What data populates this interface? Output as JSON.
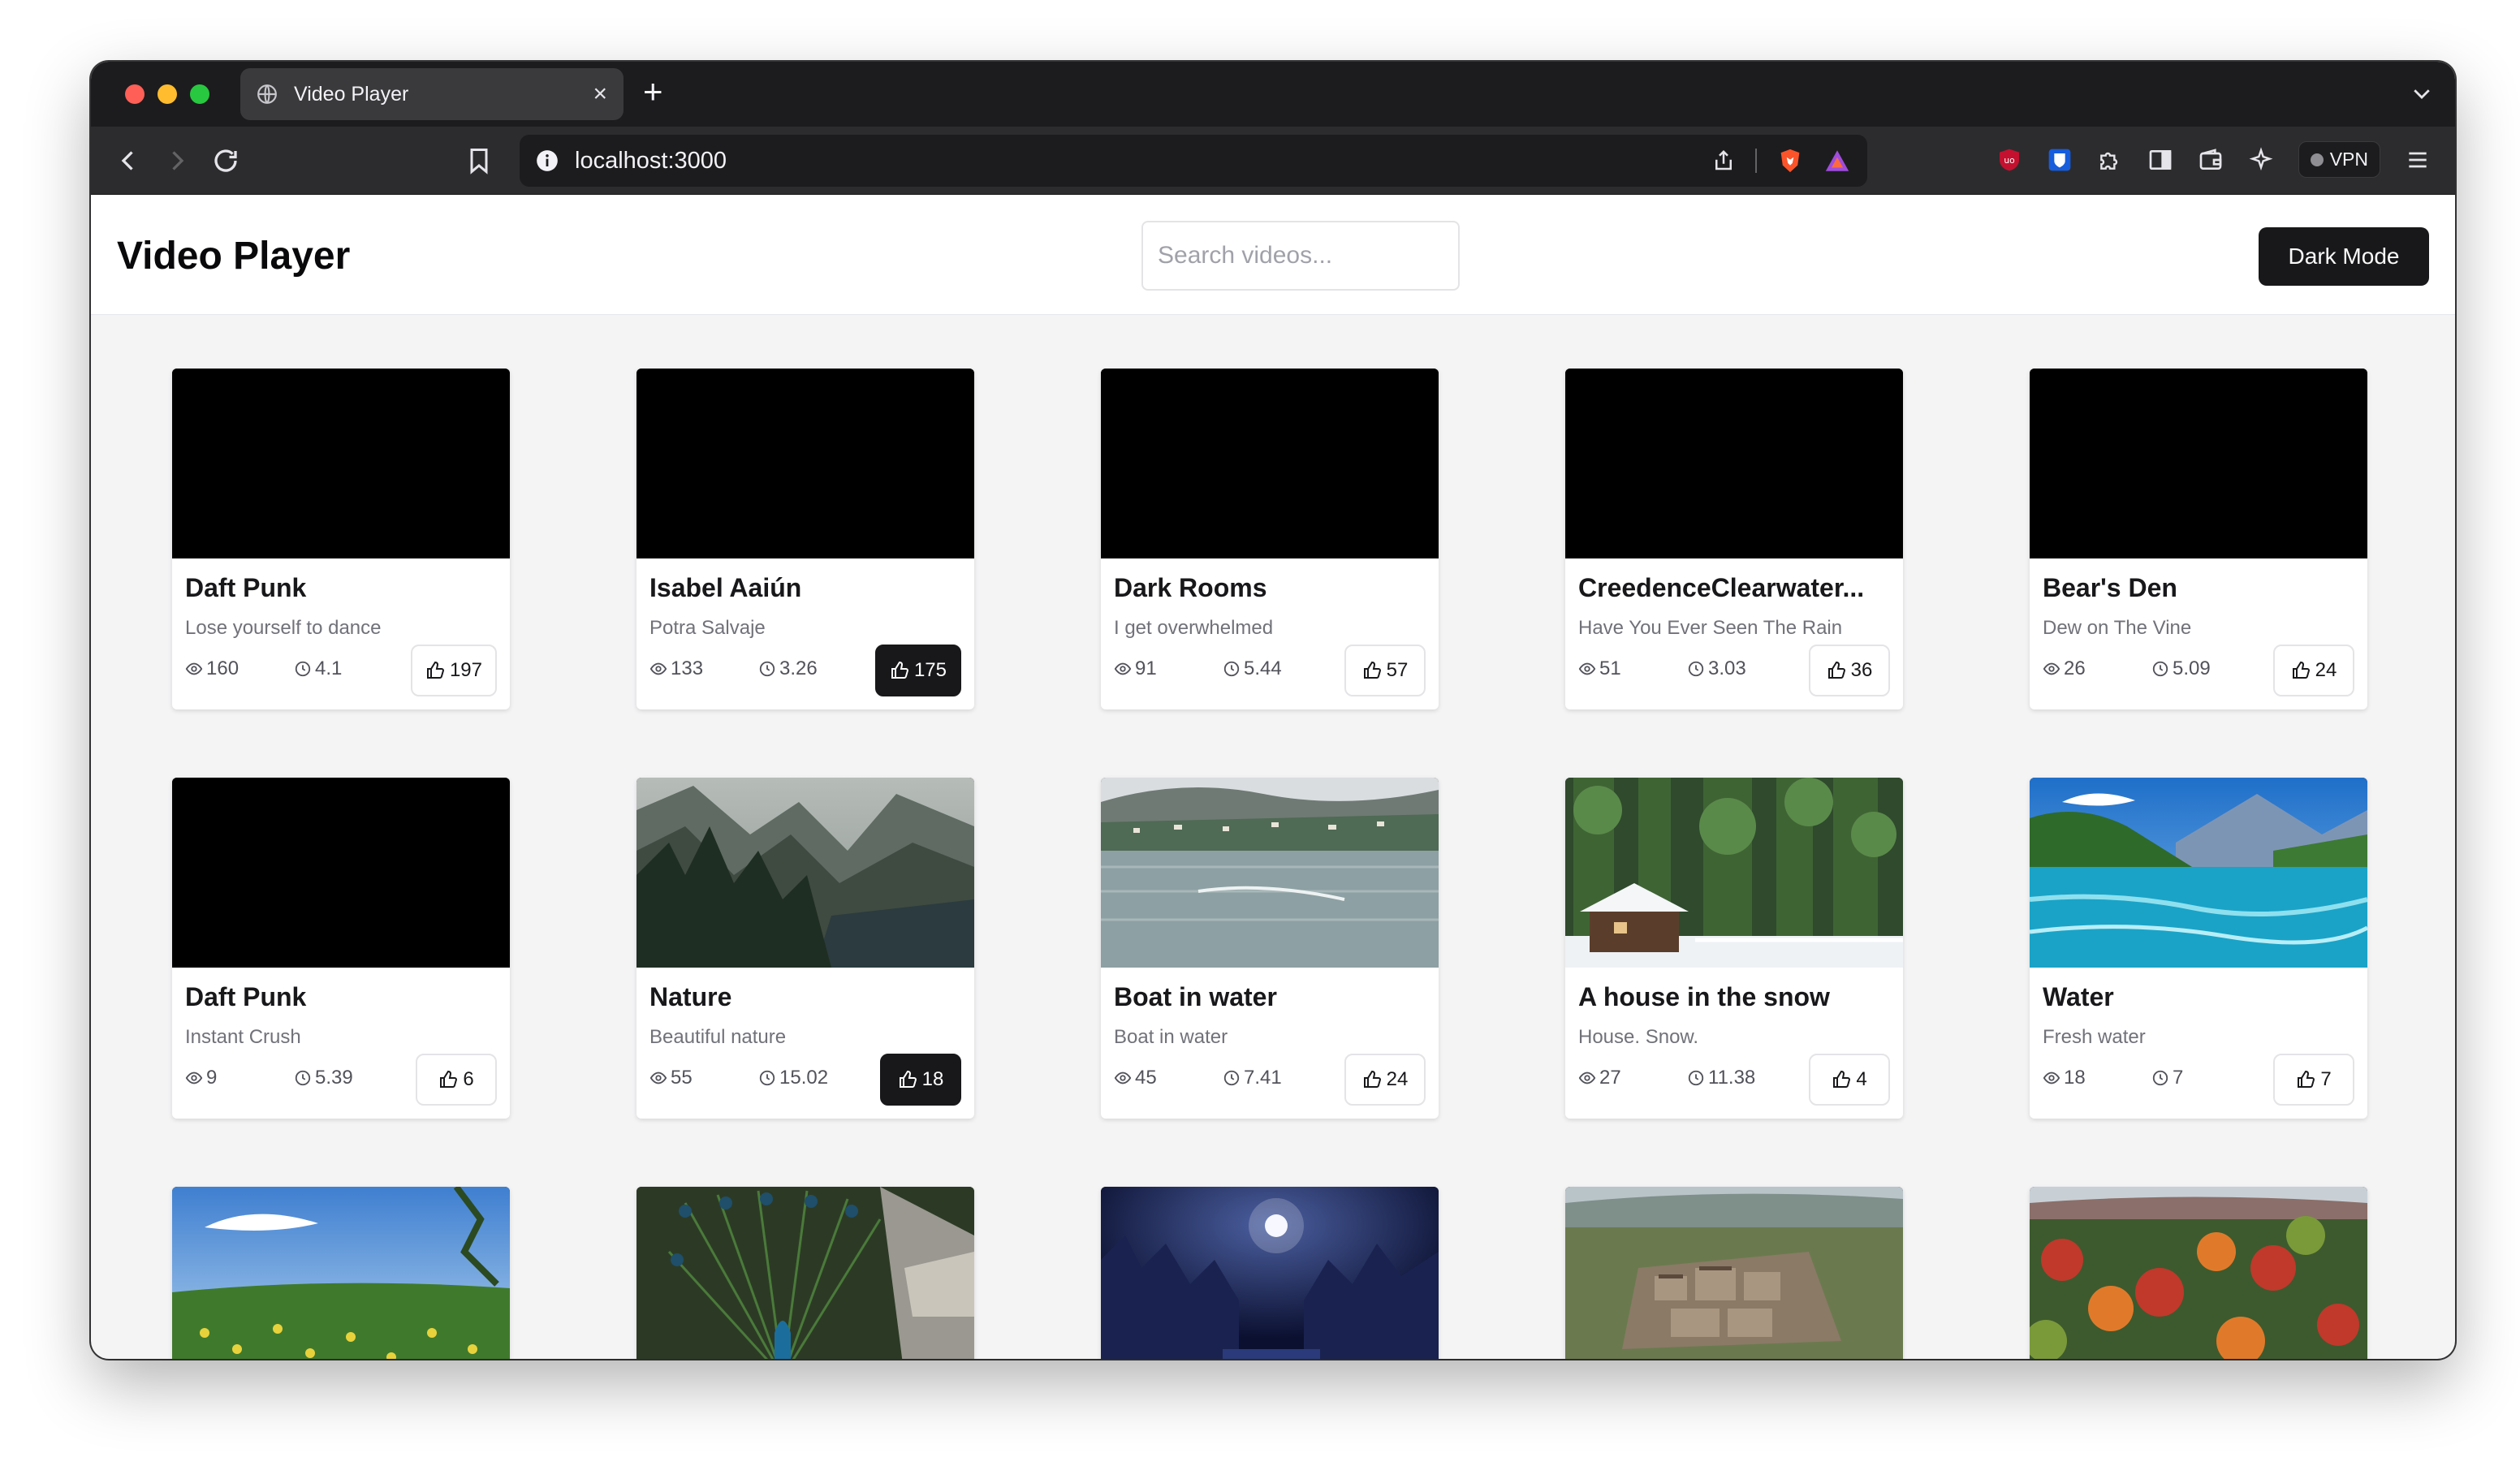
{
  "browser": {
    "tab_title": "Video Player",
    "tab_close": "×",
    "new_tab": "+",
    "url": "localhost:3000",
    "vpn_label": "VPN"
  },
  "app": {
    "title": "Video Player",
    "search_placeholder": "Search videos...",
    "dark_mode_label": "Dark Mode"
  },
  "videos": [
    {
      "title": "Daft Punk",
      "description": "Lose yourself to dance",
      "views": "160",
      "duration": "4.1",
      "likes": "197",
      "liked": false,
      "thumb": "black"
    },
    {
      "title": "Isabel Aaiún",
      "description": "Potra Salvaje",
      "views": "133",
      "duration": "3.26",
      "likes": "175",
      "liked": true,
      "thumb": "black"
    },
    {
      "title": "Dark Rooms",
      "description": "I get overwhelmed",
      "views": "91",
      "duration": "5.44",
      "likes": "57",
      "liked": false,
      "thumb": "black"
    },
    {
      "title": "CreedenceClearwater...",
      "description": "Have You Ever Seen The Rain",
      "views": "51",
      "duration": "3.03",
      "likes": "36",
      "liked": false,
      "thumb": "black"
    },
    {
      "title": "Bear's Den",
      "description": "Dew on The Vine",
      "views": "26",
      "duration": "5.09",
      "likes": "24",
      "liked": false,
      "thumb": "black"
    },
    {
      "title": "Daft Punk",
      "description": "Instant Crush",
      "views": "9",
      "duration": "5.39",
      "likes": "6",
      "liked": false,
      "thumb": "black"
    },
    {
      "title": "Nature",
      "description": "Beautiful nature",
      "views": "55",
      "duration": "15.02",
      "likes": "18",
      "liked": true,
      "thumb": "mountains"
    },
    {
      "title": "Boat in water",
      "description": "Boat in water",
      "views": "45",
      "duration": "7.41",
      "likes": "24",
      "liked": false,
      "thumb": "lake"
    },
    {
      "title": "A house in the snow",
      "description": "House. Snow.",
      "views": "27",
      "duration": "11.38",
      "likes": "4",
      "liked": false,
      "thumb": "snowhouse"
    },
    {
      "title": "Water",
      "description": "Fresh water",
      "views": "18",
      "duration": "7",
      "likes": "7",
      "liked": false,
      "thumb": "river"
    },
    {
      "title": "",
      "description": "",
      "views": "",
      "duration": "",
      "likes": "",
      "liked": false,
      "thumb": "meadow"
    },
    {
      "title": "",
      "description": "",
      "views": "",
      "duration": "",
      "likes": "",
      "liked": false,
      "thumb": "peacock"
    },
    {
      "title": "",
      "description": "",
      "views": "",
      "duration": "",
      "likes": "",
      "liked": false,
      "thumb": "night"
    },
    {
      "title": "",
      "description": "",
      "views": "",
      "duration": "",
      "likes": "",
      "liked": false,
      "thumb": "town"
    },
    {
      "title": "",
      "description": "",
      "views": "",
      "duration": "",
      "likes": "",
      "liked": false,
      "thumb": "forest"
    }
  ]
}
